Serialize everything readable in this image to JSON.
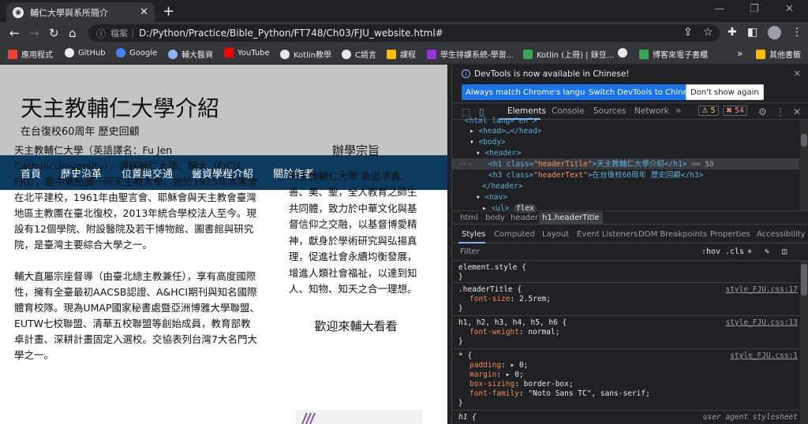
{
  "browser": {
    "tab_title": "輔仁大學與系所簡介",
    "omnibox_label": "檔案",
    "omnibox_url": "D:/Python/Practice/Bible_Python/FT748/Ch03/FJU_website.html#",
    "bookmarks": [
      {
        "label": "應用程式",
        "color": "#ea4335"
      },
      {
        "label": "GitHub",
        "color": "#e8eaed"
      },
      {
        "label": "Google",
        "color": "#4285f4"
      },
      {
        "label": "輔大醫資",
        "color": "#8ab4f8"
      },
      {
        "label": "YouTube",
        "color": "#ff0000"
      },
      {
        "label": "Kotlin教學",
        "color": "#e8eaed"
      },
      {
        "label": "C語言",
        "color": "#e8eaed"
      },
      {
        "label": "課程",
        "color": "#fbbc04"
      },
      {
        "label": "學生排課系統-學習...",
        "color": "#9334e6"
      },
      {
        "label": "Kotlin (上冊) | 錄豆...",
        "color": "#34a853"
      },
      {
        "label": "",
        "color": "#e8eaed"
      },
      {
        "label": "博客來電子書櫃",
        "color": "#34a853"
      }
    ],
    "bookmarks_more": "»",
    "other_bookmarks": "其他書籤"
  },
  "page": {
    "header_title": "天主教輔仁大學介紹",
    "header_subtitle": "在台復校60周年 歷史回顧",
    "nav": [
      "首頁",
      "歷史沿革",
      "位置與交通",
      "醫資學程介紹",
      "關於作者"
    ],
    "left_paragraphs": [
      "天主教輔仁大學（英語譯名：Fu Jen CatholicUniversity），通稱輔仁大學、輔大（FJCU、FJU），是中華民國一所天主教大學，始於1925年本篤會在北平建校，1961年由聖言會、耶穌會與天主教會臺灣地區主教團在臺北復校，2013年統合學校法人至今。現設有12個學院、附設醫院及若干博物館、圖書館與研究院，是臺灣主要綜合大學之一。",
      "輔大直屬宗座督導（由臺北總主教兼任），享有高度國際性，擁有全臺最初AACSB認證、A&HCI期刊與知名國際體育校隊。現為UMAP國家秘書處暨亞洲博雅大學聯盟、EUTW七校聯盟、清華五校聯盟等創始成員，教育部教卓計畫、深耕計畫固定入選校。交協表列台灣7大名門大學之一。"
    ],
    "right_heading": "辦學宗旨",
    "right_text": "天主教輔仁大學 為追求真、善、美、聖，全人教育之師生共同體，致力於中華文化與基督信仰之交融，以基督博愛精神，獻身於學術研究與弘揚真理，促進社會永續均衡發展，增進人類社會福祉，以達到知人、知物、知天之合一理想。",
    "right_heading2": "歡迎來輔大看看"
  },
  "devtools": {
    "banner_text": "DevTools is now available in Chinese!",
    "btn_match": "Always match Chrome's language",
    "btn_switch": "Switch DevTools to Chinese",
    "btn_dont": "Don't show again",
    "tabs": [
      "Elements",
      "Console",
      "Sources",
      "Network"
    ],
    "more_tabs": "»",
    "warn_count": "5",
    "error_count": "54",
    "dom": {
      "l0_open": "<html lang=\"en\">",
      "l1": "<head>…</head>",
      "l2": "<body>",
      "l3": "<header>",
      "l4_tag_open": "<h1 class=",
      "l4_attr": "\"headerTitle\"",
      "l4_text": ">天主教輔仁大學介紹</h1>",
      "l4_eq": "== $0",
      "l5_tag_open": "<h3 class=",
      "l5_attr": "\"headerText\"",
      "l5_text": ">在台復校60周年 歷史回顧</h3>",
      "l6": "</header>",
      "l7": "<nav>",
      "l8": "<ul>",
      "l8_badge": "flex"
    },
    "breadcrumbs": [
      "html",
      "body",
      "header",
      "h1.headerTitle"
    ],
    "sub_tabs": [
      "Styles",
      "Computed",
      "Layout",
      "Event Listeners",
      "DOM Breakpoints",
      "Properties",
      "Accessibility"
    ],
    "filter_placeholder": "Filter",
    "filter_hov": ":hov",
    "filter_cls": ".cls",
    "rules": {
      "r0_sel": "element.style {",
      "r0_close": "}",
      "r1_sel": ".headerTitle {",
      "r1_src": "style_FJU.css:17",
      "r1_prop": "font-size",
      "r1_val": "2.5rem;",
      "r1_close": "}",
      "r2_sel": "h1, h2, h3, h4, h5, h6 {",
      "r2_src": "style_FJU.css:13",
      "r2_prop": "font-weight",
      "r2_val": "normal;",
      "r2_close": "}",
      "r3_sel": "* {",
      "r3_src": "style_FJU.css:1",
      "r3_p1": "padding",
      "r3_v1": "0;",
      "r3_p2": "margin",
      "r3_v2": "0;",
      "r3_p3": "box-sizing",
      "r3_v3": "border-box;",
      "r3_p4": "font-family",
      "r3_v4": "\"Noto Sans TC\", sans-serif;",
      "r3_close": "}",
      "r4_sel": "h1 {",
      "r4_src": "user agent stylesheet"
    }
  }
}
